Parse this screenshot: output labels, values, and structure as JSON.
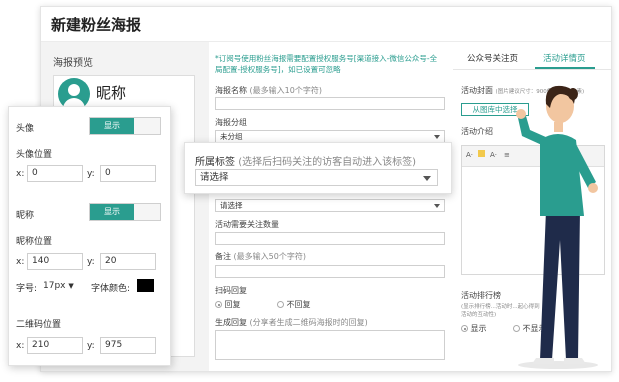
{
  "main": {
    "title": "新建粉丝海报",
    "preview_title": "海报预览",
    "nickname": "昵称"
  },
  "form": {
    "notice": "*订阅号使用粉丝海报需要配置授权服务号[渠道接入-微信公众号-全局配置-授权服务号]，如已设置可忽略",
    "name_label": "海报名称",
    "name_hint": "(最多输入10个字符)",
    "name_value": "",
    "group_label": "海报分组",
    "group_value": "未分组",
    "select_value": "请选择",
    "follow_count_label": "活动需要关注数量",
    "follow_count_value": "",
    "remark_label": "备注",
    "remark_hint": "(最多输入50个字符)",
    "remark_value": "",
    "scan_reply_label": "扫码回复",
    "scan_reply_options": [
      "回复",
      "不回复"
    ],
    "gen_reply_label": "生成回复",
    "gen_reply_hint": "(分享者生成二维码海报时的回复)",
    "gen_reply_value": ""
  },
  "right_panel": {
    "tabs": [
      "公众号关注页",
      "活动详情页"
    ],
    "active_tab": "活动详情页",
    "cover_label": "活动封面",
    "cover_hint": "(图片建议尺寸：900像素*900像素)",
    "cover_button": "从图库中选择",
    "intro_label": "活动介绍",
    "rank_label": "活动排行榜",
    "rank_hint": "(显示排行榜...活动时...起心得到活动的互动性)",
    "rank_options": [
      "显示",
      "不显示"
    ]
  },
  "avatar_panel": {
    "avatar_label": "头像",
    "avatar_toggle": "显示",
    "avatar_pos_label": "头像位置",
    "avatar_x_label": "x:",
    "avatar_x": "0",
    "avatar_y_label": "y:",
    "avatar_y": "0",
    "nick_label": "昵称",
    "nick_toggle": "显示",
    "nick_pos_label": "昵称位置",
    "nick_x_label": "x:",
    "nick_x": "140",
    "nick_y_label": "y:",
    "nick_y": "20",
    "font_size_label": "字号:",
    "font_size_value": "17px",
    "font_color_label": "字体颜色:",
    "font_color": "#000000",
    "qr_pos_label": "二维码位置",
    "qr_x_label": "x:",
    "qr_x": "210",
    "qr_y_label": "y:",
    "qr_y": "975"
  },
  "tag_popup": {
    "label": "所属标签",
    "hint": "(选择后扫码关注的访客自动进入该标签)",
    "value": "请选择"
  },
  "colors": {
    "accent": "#2a9d8f",
    "shirt": "#2a9d8f",
    "pants": "#1f2b4a"
  }
}
